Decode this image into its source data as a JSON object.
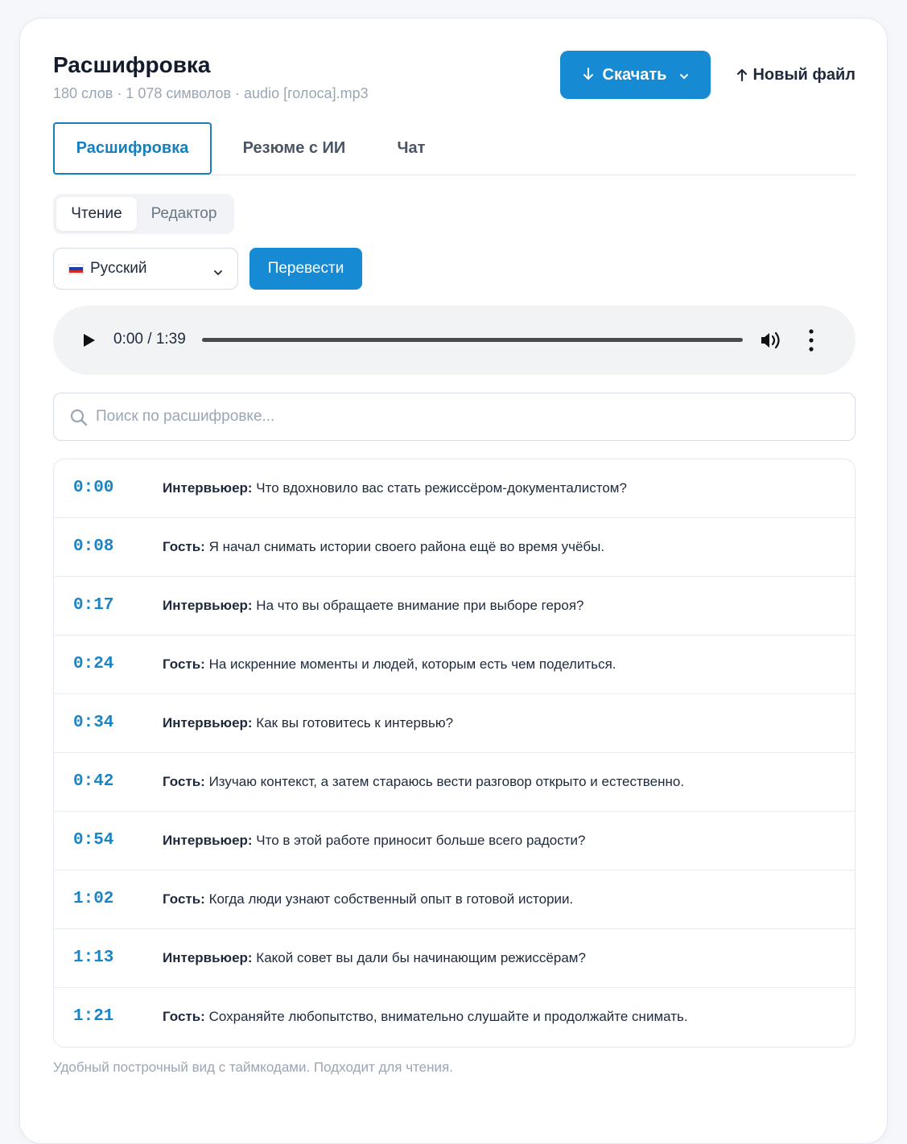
{
  "header": {
    "title": "Расшифровка",
    "subtitle": "180 слов · 1 078 символов · audio [голоса].mp3",
    "download_label": "Скачать",
    "new_file_label": "Новый файл"
  },
  "tabs": [
    {
      "label": "Расшифровка",
      "active": true
    },
    {
      "label": "Резюме с ИИ",
      "active": false
    },
    {
      "label": "Чат",
      "active": false
    }
  ],
  "view_toggle": {
    "reading_label": "Чтение",
    "editor_label": "Редактор",
    "selected": "Чтение"
  },
  "language": {
    "selected": "Русский",
    "translate_label": "Перевести"
  },
  "player": {
    "time": "0:00 / 1:39"
  },
  "search": {
    "placeholder": "Поиск по расшифровке..."
  },
  "transcript": [
    {
      "time": "0:00",
      "speaker": "Интервьюер:",
      "text": " Что вдохновило вас стать режиссёром-документалистом?"
    },
    {
      "time": "0:08",
      "speaker": "Гость:",
      "text": " Я начал снимать истории своего района ещё во время учёбы."
    },
    {
      "time": "0:17",
      "speaker": "Интервьюер:",
      "text": " На что вы обращаете внимание при выборе героя?"
    },
    {
      "time": "0:24",
      "speaker": "Гость:",
      "text": " На искренние моменты и людей, которым есть чем поделиться."
    },
    {
      "time": "0:34",
      "speaker": "Интервьюер:",
      "text": " Как вы готовитесь к интервью?"
    },
    {
      "time": "0:42",
      "speaker": "Гость:",
      "text": " Изучаю контекст, а затем стараюсь вести разговор открыто и естественно."
    },
    {
      "time": "0:54",
      "speaker": "Интервьюер:",
      "text": " Что в этой работе приносит больше всего радости?"
    },
    {
      "time": "1:02",
      "speaker": "Гость:",
      "text": " Когда люди узнают собственный опыт в готовой истории."
    },
    {
      "time": "1:13",
      "speaker": "Интервьюер:",
      "text": " Какой совет вы дали бы начинающим режиссёрам?"
    },
    {
      "time": "1:21",
      "speaker": "Гость:",
      "text": " Сохраняйте любопытство, внимательно слушайте и продолжайте снимать."
    }
  ],
  "footer_note": "Удобный построчный вид с таймкодами. Подходит для чтения.",
  "colors": {
    "accent": "#168bd3",
    "timestamp": "#1a84c5",
    "muted": "#9aa6b5"
  }
}
